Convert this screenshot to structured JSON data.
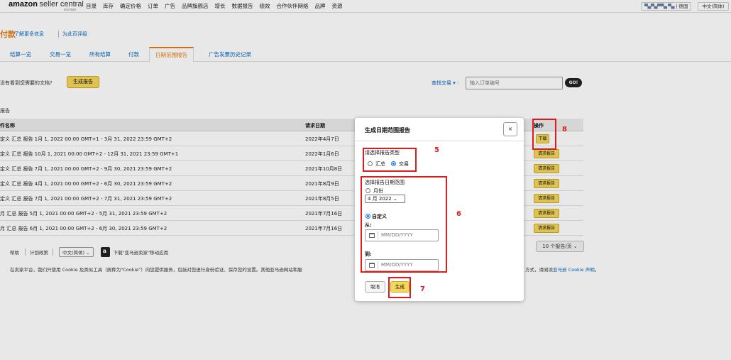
{
  "topnav": {
    "logo_main": "amazon",
    "logo_sub": "seller central",
    "logo_region": "europe",
    "items": [
      "目录",
      "库存",
      "确定价格",
      "订单",
      "广告",
      "品牌旗舰店",
      "增长",
      "数据报告",
      "绩效",
      "合作伙伴网络",
      "品牌",
      "资源"
    ],
    "account_blurred": "▀▄▀▄▀▀▄ ▀▄",
    "account_suffix": "| 德国",
    "language": "中文(简体)"
  },
  "page": {
    "title": "付款",
    "learn_more": "了解更多信息",
    "rate_page": "为此页评级"
  },
  "tabs": [
    {
      "label": "结算一览",
      "active": false
    },
    {
      "label": "交易一览",
      "active": false
    },
    {
      "label": "所有结算",
      "active": false
    },
    {
      "label": "付款",
      "active": false
    },
    {
      "label": "日期范围报告",
      "active": true
    },
    {
      "label": "广告发票历史记录",
      "active": false
    }
  ],
  "toolbar": {
    "no_doc_text": "没有看到您需要的文档?",
    "generate_report_button": "生成报告",
    "find_transaction_label": "查找交易 ▾ :",
    "search_placeholder": "输入订单编号",
    "go_button": "GO!"
  },
  "reports_label": "报告",
  "table": {
    "headers": {
      "name": "件名称",
      "date": "请求日期",
      "action": "操作"
    },
    "rows": [
      {
        "name": "定义 汇总 报告 1月 1, 2022 00:00 GMT+1 - 3月 31, 2022 23:59 GMT+2",
        "date": "2022年4月7日",
        "action": "下载"
      },
      {
        "name": "定义 汇总 报告 10月 1, 2021 00:00 GMT+2 - 12月 31, 2021 23:59 GMT+1",
        "date": "2022年1月6日",
        "action": "请求报告"
      },
      {
        "name": "定义 汇总 报告 7月 1, 2021 00:00 GMT+2 - 9月 30, 2021 23:59 GMT+2",
        "date": "2021年10月8日",
        "action": "请求报告"
      },
      {
        "name": "定义 汇总 报告 4月 1, 2021 00:00 GMT+2 - 6月 30, 2021 23:59 GMT+2",
        "date": "2021年8月9日",
        "action": "请求报告"
      },
      {
        "name": "定义 汇总 报告 7月 1, 2021 00:00 GMT+2 - 7月 31, 2021 23:59 GMT+2",
        "date": "2021年8月5日",
        "action": "请求报告"
      },
      {
        "name": "月 汇总 报告 5月 1, 2021 00:00 GMT+2 - 5月 31, 2021 23:59 GMT+2",
        "date": "2021年7月16日",
        "action": "请求报告"
      },
      {
        "name": "月 汇总 报告 6月 1, 2021 00:00 GMT+2 - 6月 30, 2021 23:59 GMT+2",
        "date": "2021年7月16日",
        "action": "请求报告"
      }
    ],
    "per_page": "10 个报告/页 ⌄"
  },
  "footer": {
    "help": "帮助",
    "policy": "计划政策",
    "language": "中文(简体) ⌄",
    "app_download": "下载\"亚马逊卖家\"移动应用",
    "cookie_text": "在卖家平台，我们只使用 Cookie 及类似工具（统称为\"Cookie\"）向您提供服务，包括对您进行身份验证、保存您的设置。其他亚马逊网站和服",
    "cookie_right": "方式，请阅读",
    "cookie_link": "亚马逊 Cookie 声明",
    "cookie_end": "。"
  },
  "modal": {
    "title": "生成日期范围报告",
    "close": "×",
    "type_label": "请选择报告类型",
    "type_options": [
      {
        "label": "汇总",
        "checked": false
      },
      {
        "label": "交易",
        "checked": true
      }
    ],
    "range_label": "选择报告日期范围",
    "monthly_label": "月份",
    "monthly_checked": false,
    "month_value": "4 月 2022 ⌄",
    "custom_label": "自定义",
    "custom_checked": true,
    "from_label": "从:",
    "to_label": "到:",
    "date_placeholder": "MM/DD/YYYY",
    "cancel_button": "取消",
    "generate_button": "生成"
  },
  "annotations": {
    "n5": "5",
    "n6": "6",
    "n7": "7",
    "n8": "8"
  },
  "colors": {
    "accent": "#e47911",
    "button": "#f5d65b",
    "link": "#0066c0",
    "annotation": "#e01b1b"
  }
}
